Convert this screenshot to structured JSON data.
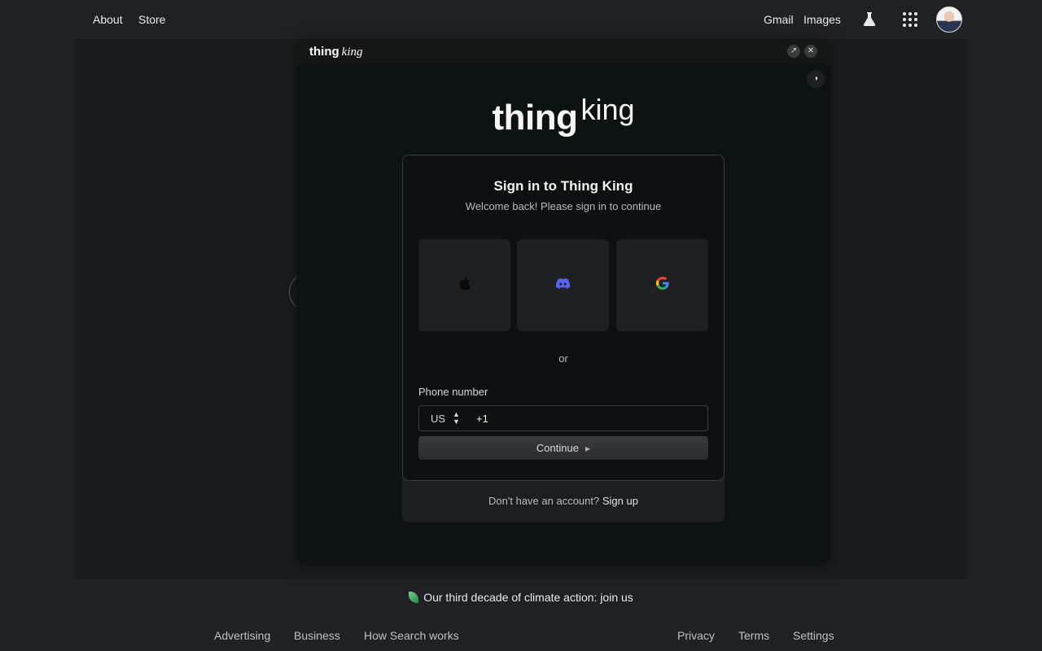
{
  "topbar": {
    "about": "About",
    "store": "Store",
    "gmail": "Gmail",
    "images": "Images"
  },
  "popup": {
    "brand_thing": "thing",
    "brand_king": "king",
    "open_icon": "↗",
    "close_icon": "✕",
    "theme_icon": "◑"
  },
  "logo": {
    "thing": "thing",
    "king": "king"
  },
  "signin": {
    "title": "Sign in to Thing King",
    "subtitle": "Welcome back! Please sign in to continue",
    "or": "or",
    "phone_label": "Phone number",
    "country": "US",
    "dial_code": "+1",
    "continue": "Continue",
    "no_account": "Don't have an account?",
    "sign_up": "Sign up",
    "providers": [
      "apple-icon",
      "discord-icon",
      "google-icon"
    ]
  },
  "footer": {
    "climate": "Our third decade of climate action: join us",
    "advertising": "Advertising",
    "business": "Business",
    "how_search": "How Search works",
    "privacy": "Privacy",
    "terms": "Terms",
    "settings": "Settings"
  },
  "colors": {
    "page_bg": "#202124",
    "popup_bg": "#0d1313",
    "discord": "#5865f2"
  }
}
